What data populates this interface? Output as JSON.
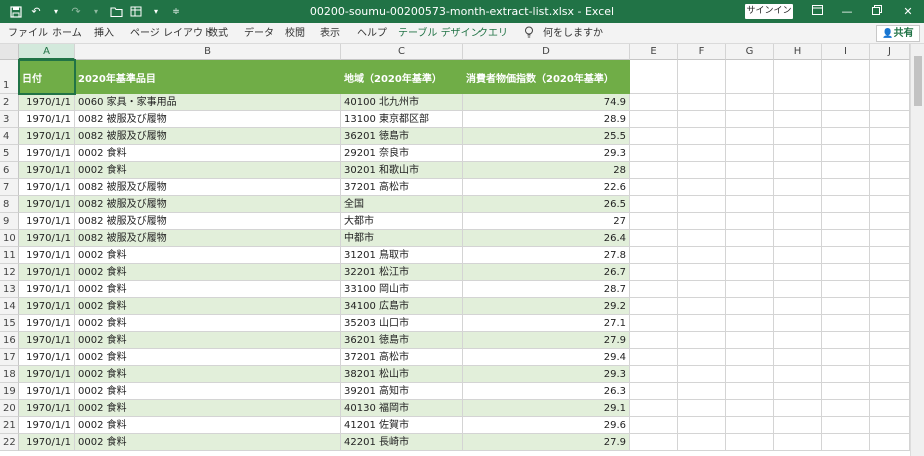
{
  "titlebar": {
    "save_icon": "save-icon",
    "undo_icon": "undo-icon",
    "redo_icon": "redo-icon",
    "open_icon": "open-folder-icon",
    "customize_icon": "customize-qat-icon",
    "title": "00200-soumu-00200573-month-extract-list.xlsx  -  Excel",
    "signin": "サインイン",
    "accent": "#217346"
  },
  "ribbon": {
    "tabs": [
      "ファイル",
      "ホーム",
      "挿入",
      "ページ レイアウト",
      "数式",
      "データ",
      "校閲",
      "表示",
      "ヘルプ",
      "テーブル デザイン",
      "クエリ"
    ],
    "tell_me": "何をしますか",
    "share": "共有"
  },
  "sheet": {
    "columns": [
      "A",
      "B",
      "C",
      "D",
      "E",
      "F",
      "G",
      "H",
      "I",
      "J"
    ],
    "header_row": {
      "row_num": "1",
      "cells": [
        "日付",
        "2020年基準品目",
        "地域（2020年基準）",
        "消費者物価指数（2020年基準）"
      ]
    },
    "rows": [
      {
        "n": "2",
        "date": "1970/1/1",
        "item": "0060 家具・家事用品",
        "region": "40100 北九州市",
        "value": "74.9"
      },
      {
        "n": "3",
        "date": "1970/1/1",
        "item": "0082 被服及び履物",
        "region": "13100 東京都区部",
        "value": "28.9"
      },
      {
        "n": "4",
        "date": "1970/1/1",
        "item": "0082 被服及び履物",
        "region": "36201 徳島市",
        "value": "25.5"
      },
      {
        "n": "5",
        "date": "1970/1/1",
        "item": "0002 食料",
        "region": "29201 奈良市",
        "value": "29.3"
      },
      {
        "n": "6",
        "date": "1970/1/1",
        "item": "0002 食料",
        "region": "30201 和歌山市",
        "value": "28"
      },
      {
        "n": "7",
        "date": "1970/1/1",
        "item": "0082 被服及び履物",
        "region": "37201 高松市",
        "value": "22.6"
      },
      {
        "n": "8",
        "date": "1970/1/1",
        "item": "0082 被服及び履物",
        "region": "全国",
        "value": "26.5"
      },
      {
        "n": "9",
        "date": "1970/1/1",
        "item": "0082 被服及び履物",
        "region": "大都市",
        "value": "27"
      },
      {
        "n": "10",
        "date": "1970/1/1",
        "item": "0082 被服及び履物",
        "region": "中都市",
        "value": "26.4"
      },
      {
        "n": "11",
        "date": "1970/1/1",
        "item": "0002 食料",
        "region": "31201 鳥取市",
        "value": "27.8"
      },
      {
        "n": "12",
        "date": "1970/1/1",
        "item": "0002 食料",
        "region": "32201 松江市",
        "value": "26.7"
      },
      {
        "n": "13",
        "date": "1970/1/1",
        "item": "0002 食料",
        "region": "33100 岡山市",
        "value": "28.7"
      },
      {
        "n": "14",
        "date": "1970/1/1",
        "item": "0002 食料",
        "region": "34100 広島市",
        "value": "29.2"
      },
      {
        "n": "15",
        "date": "1970/1/1",
        "item": "0002 食料",
        "region": "35203 山口市",
        "value": "27.1"
      },
      {
        "n": "16",
        "date": "1970/1/1",
        "item": "0002 食料",
        "region": "36201 徳島市",
        "value": "27.9"
      },
      {
        "n": "17",
        "date": "1970/1/1",
        "item": "0002 食料",
        "region": "37201 高松市",
        "value": "29.4"
      },
      {
        "n": "18",
        "date": "1970/1/1",
        "item": "0002 食料",
        "region": "38201 松山市",
        "value": "29.3"
      },
      {
        "n": "19",
        "date": "1970/1/1",
        "item": "0002 食料",
        "region": "39201 高知市",
        "value": "26.3"
      },
      {
        "n": "20",
        "date": "1970/1/1",
        "item": "0002 食料",
        "region": "40130 福岡市",
        "value": "29.1"
      },
      {
        "n": "21",
        "date": "1970/1/1",
        "item": "0002 食料",
        "region": "41201 佐賀市",
        "value": "29.6"
      },
      {
        "n": "22",
        "date": "1970/1/1",
        "item": "0002 食料",
        "region": "42201 長崎市",
        "value": "27.9"
      }
    ],
    "band_color": "#e2efda",
    "header_color": "#70ad47"
  }
}
